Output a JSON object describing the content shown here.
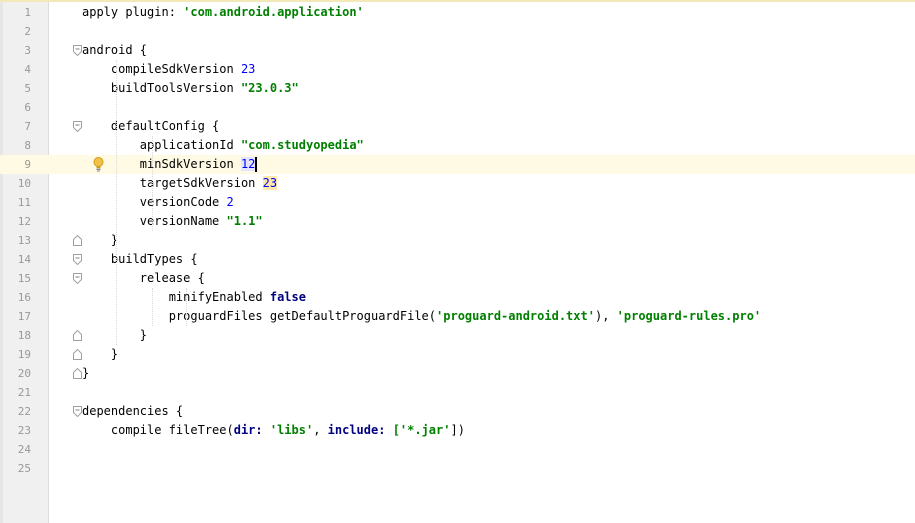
{
  "editor": {
    "lines": [
      {
        "n": "1",
        "segs": [
          {
            "t": "apply plugin: ",
            "c": ""
          },
          {
            "t": "'com.android.application'",
            "c": "str"
          }
        ]
      },
      {
        "n": "2",
        "segs": []
      },
      {
        "n": "3",
        "segs": [
          {
            "t": "android {",
            "c": ""
          }
        ]
      },
      {
        "n": "4",
        "segs": [
          {
            "t": "    compileSdkVersion ",
            "c": ""
          },
          {
            "t": "23",
            "c": "num"
          }
        ]
      },
      {
        "n": "5",
        "segs": [
          {
            "t": "    buildToolsVersion ",
            "c": ""
          },
          {
            "t": "\"23.0.3\"",
            "c": "str"
          }
        ]
      },
      {
        "n": "6",
        "segs": []
      },
      {
        "n": "7",
        "segs": [
          {
            "t": "    defaultConfig {",
            "c": ""
          }
        ]
      },
      {
        "n": "8",
        "segs": [
          {
            "t": "        applicationId ",
            "c": ""
          },
          {
            "t": "\"com.studyopedia\"",
            "c": "str"
          }
        ]
      },
      {
        "n": "9",
        "segs": [
          {
            "t": "        minSdkVersion ",
            "c": ""
          },
          {
            "t": "12",
            "c": "num num-hl"
          }
        ]
      },
      {
        "n": "10",
        "segs": [
          {
            "t": "        targetSdkVersion ",
            "c": ""
          },
          {
            "t": "23",
            "c": "num num-hl2"
          }
        ]
      },
      {
        "n": "11",
        "segs": [
          {
            "t": "        versionCode ",
            "c": ""
          },
          {
            "t": "2",
            "c": "num"
          }
        ]
      },
      {
        "n": "12",
        "segs": [
          {
            "t": "        versionName ",
            "c": ""
          },
          {
            "t": "\"1.1\"",
            "c": "str"
          }
        ]
      },
      {
        "n": "13",
        "segs": [
          {
            "t": "    }",
            "c": ""
          }
        ]
      },
      {
        "n": "14",
        "segs": [
          {
            "t": "    buildTypes {",
            "c": ""
          }
        ]
      },
      {
        "n": "15",
        "segs": [
          {
            "t": "        release {",
            "c": ""
          }
        ]
      },
      {
        "n": "16",
        "segs": [
          {
            "t": "            minifyEnabled ",
            "c": ""
          },
          {
            "t": "false",
            "c": "kw"
          }
        ]
      },
      {
        "n": "17",
        "segs": [
          {
            "t": "            proguardFiles getDefaultProguardFile(",
            "c": ""
          },
          {
            "t": "'proguard-android.txt'",
            "c": "str"
          },
          {
            "t": "), ",
            "c": ""
          },
          {
            "t": "'proguard-rules.pro'",
            "c": "str"
          }
        ]
      },
      {
        "n": "18",
        "segs": [
          {
            "t": "        }",
            "c": ""
          }
        ]
      },
      {
        "n": "19",
        "segs": [
          {
            "t": "    }",
            "c": ""
          }
        ]
      },
      {
        "n": "20",
        "segs": [
          {
            "t": "}",
            "c": ""
          }
        ]
      },
      {
        "n": "21",
        "segs": []
      },
      {
        "n": "22",
        "segs": [
          {
            "t": "dependencies {",
            "c": ""
          }
        ]
      },
      {
        "n": "23",
        "segs": [
          {
            "t": "    compile fileTree(",
            "c": ""
          },
          {
            "t": "dir: ",
            "c": "kw"
          },
          {
            "t": "'libs'",
            "c": "str"
          },
          {
            "t": ", ",
            "c": ""
          },
          {
            "t": "include: ",
            "c": "kw"
          },
          {
            "t": "['*.jar'",
            "c": "str"
          },
          {
            "t": "])",
            "c": ""
          }
        ]
      },
      {
        "n": "24",
        "segs": []
      },
      {
        "n": "25",
        "segs": []
      }
    ],
    "current_line": "9",
    "fold_markers": [
      {
        "line": "3",
        "kind": "open"
      },
      {
        "line": "7",
        "kind": "open"
      },
      {
        "line": "13",
        "kind": "close"
      },
      {
        "line": "14",
        "kind": "open"
      },
      {
        "line": "15",
        "kind": "open"
      },
      {
        "line": "18",
        "kind": "close"
      },
      {
        "line": "19",
        "kind": "close"
      },
      {
        "line": "20",
        "kind": "close"
      },
      {
        "line": "22",
        "kind": "open"
      }
    ],
    "intention_icon": "lightbulb-icon",
    "intention_line": "9"
  }
}
